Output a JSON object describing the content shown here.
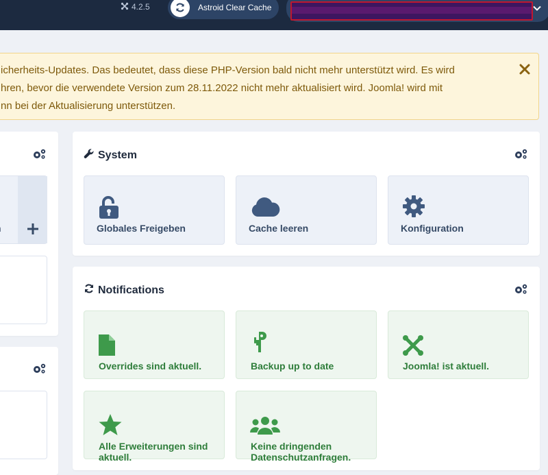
{
  "header": {
    "version": "4.2.5",
    "cache_button_label": "Astroid Clear Cache"
  },
  "alert": {
    "lines": [
      "icherheits-Updates. Das bedeutet, dass diese PHP-Version bald nicht mehr unterstützt wird. Es wird",
      "hren, bevor die verwendete Version zum 28.11.2022 nicht mehr aktualisiert wird. Joomla! wird mit",
      "nn bei der Aktualisierung unterstützen."
    ]
  },
  "left_panel": {
    "partial_label": "n"
  },
  "system": {
    "title": "System",
    "tiles": [
      {
        "label": "Globales Freigeben",
        "icon": "unlock-icon"
      },
      {
        "label": "Cache leeren",
        "icon": "cloud-icon"
      },
      {
        "label": "Konfiguration",
        "icon": "gear-icon"
      }
    ]
  },
  "notifications": {
    "title": "Notifications",
    "tiles": [
      {
        "label": "Overrides sind aktuell.",
        "icon": "file-icon"
      },
      {
        "label": "Backup up to date",
        "icon": "backup-icon"
      },
      {
        "label": "Joomla! ist aktuell.",
        "icon": "joomla-icon"
      },
      {
        "label": "Alle Erweiterungen sind aktuell.",
        "icon": "star-icon"
      },
      {
        "label": "Keine dringenden Datenschutzanfragen.",
        "icon": "users-icon"
      }
    ]
  },
  "colors": {
    "topbar": "#1c2a40",
    "alert_bg": "#fdf5dc",
    "alert_text": "#7e5a0b",
    "success": "#3e9a4b",
    "system_icon": "#405a80"
  }
}
